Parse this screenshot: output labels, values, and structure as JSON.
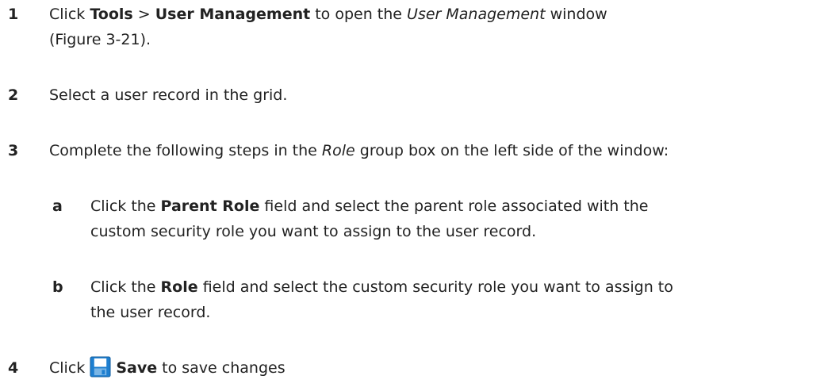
{
  "steps": [
    {
      "number": "1",
      "click": "Click",
      "menu": "Tools",
      "separator": ">",
      "item": "User Management",
      "mid": "to open the",
      "window": "User Management",
      "tail": "window",
      "line2": "(Figure 3-21)."
    },
    {
      "number": "2",
      "text": "Select a user record in the grid."
    },
    {
      "number": "3",
      "pre": "Complete the following steps in the",
      "group": "Role",
      "post": "group box on the left side of the window:"
    },
    {
      "number": "4",
      "click": "Click",
      "save": "Save",
      "post": "to save changes",
      "icon": "save-icon"
    }
  ],
  "substeps": [
    {
      "letter": "a",
      "click": "Click the",
      "field": "Parent Role",
      "post": "field and select the parent role associated with the",
      "line2": "custom security role you want to assign to the user record."
    },
    {
      "letter": "b",
      "click": "Click the",
      "field": "Role",
      "post": "field and select the custom security role you want to assign to",
      "line2": "the user record."
    }
  ],
  "colors": {
    "text": "#222222",
    "save_icon_blue": "#1e7fd0",
    "save_icon_label": "#ffffff"
  }
}
